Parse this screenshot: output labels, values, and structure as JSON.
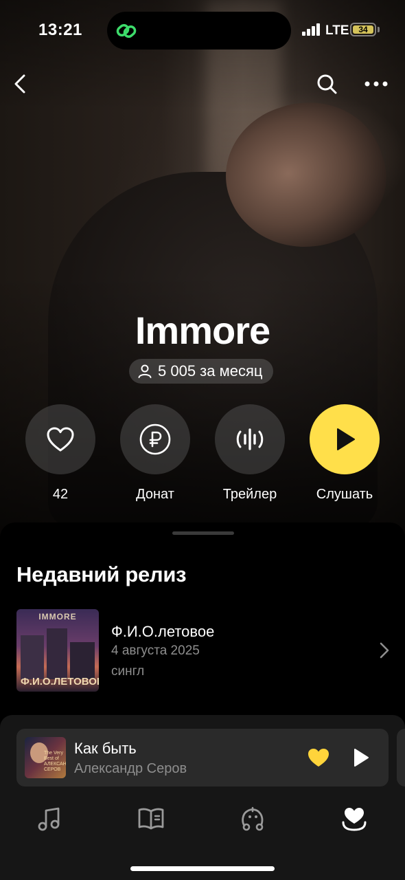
{
  "status_bar": {
    "time": "13:21",
    "network": "LTE",
    "battery": "34"
  },
  "artist": {
    "name": "Immore",
    "listeners": "5 005 за месяц"
  },
  "actions": [
    {
      "label": "42",
      "icon": "heart-icon"
    },
    {
      "label": "Донат",
      "icon": "ruble-icon"
    },
    {
      "label": "Трейлер",
      "icon": "waveform-icon"
    },
    {
      "label": "Слушать",
      "icon": "play-icon"
    }
  ],
  "recent_release": {
    "section_title": "Недавний релиз",
    "title": "Ф.И.О.летовое",
    "date": "4 августа 2025",
    "type": "сингл",
    "cover_top": "IMMORE",
    "cover_bottom": "Ф.И.О.ЛЕТОВОЕ"
  },
  "now_playing": {
    "title": "Как быть",
    "artist": "Александр Серов",
    "cover_text": "The Very Best of АЛЕКСАНДР СЕРОВ",
    "liked": true
  },
  "tabs": [
    {
      "name": "music",
      "icon": "music-note-icon"
    },
    {
      "name": "books",
      "icon": "book-icon"
    },
    {
      "name": "kids",
      "icon": "kids-icon"
    },
    {
      "name": "collection",
      "icon": "heart-collection-icon",
      "active": true
    }
  ],
  "colors": {
    "accent": "#ffdf4a",
    "like": "#ffd43b",
    "muted": "#8e8e8e"
  }
}
